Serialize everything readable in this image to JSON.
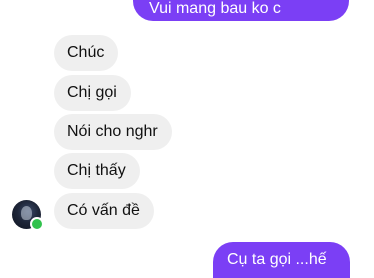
{
  "conversation": {
    "outgoing_top": "Vui mang bau ko c",
    "incoming": [
      "Chúc",
      "Chị gọi",
      "Nói cho nghr",
      "Chị thấy",
      "Có vấn đề"
    ],
    "outgoing_bottom": "Cụ ta gọi ...hế"
  },
  "colors": {
    "outgoing_bubble": "#7b3ff5",
    "incoming_bubble": "#efefef",
    "online_dot": "#31c24d"
  }
}
